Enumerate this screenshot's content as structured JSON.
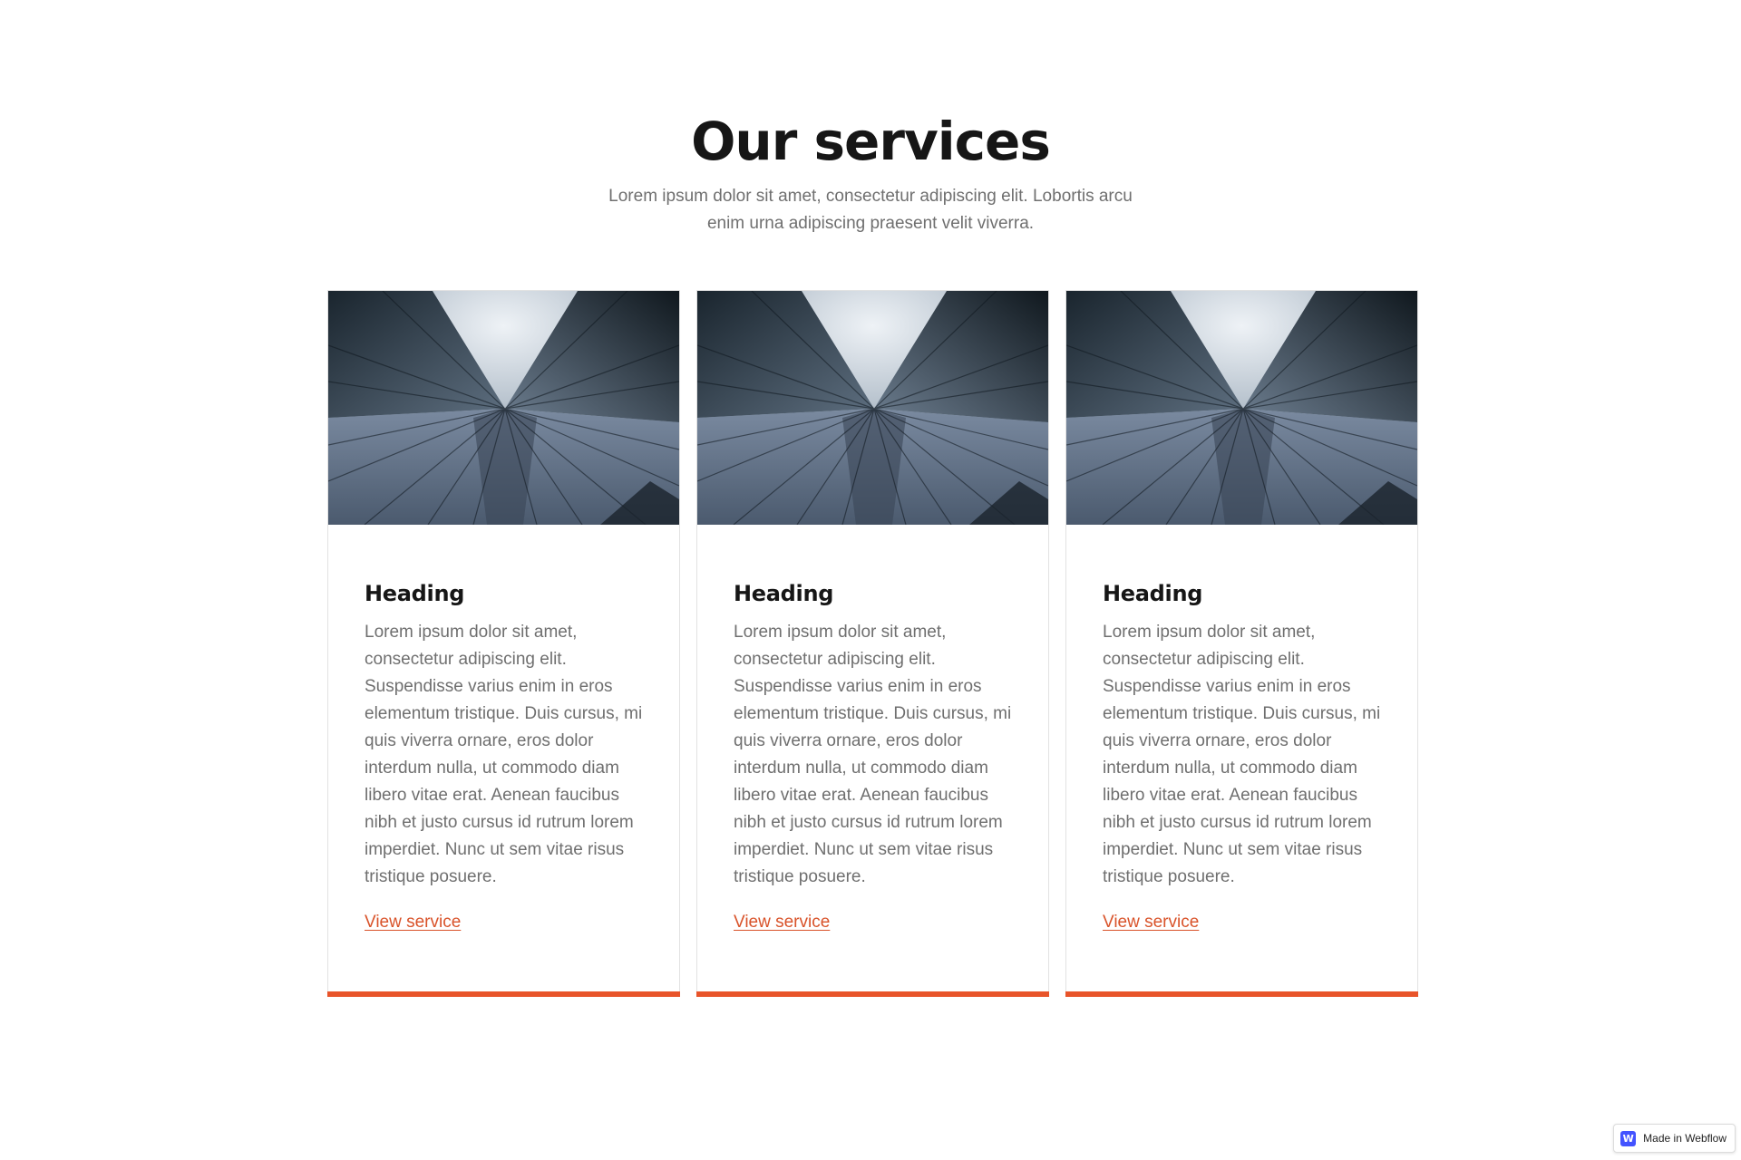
{
  "section": {
    "title": "Our services",
    "subtitle": "Lorem ipsum dolor sit amet, consectetur adipiscing elit. Lobortis arcu enim urna adipiscing praesent velit viverra."
  },
  "colors": {
    "accent": "#e8542a",
    "link": "#d9532a"
  },
  "cards": [
    {
      "image": "skyscraper-photo",
      "heading": "Heading",
      "text": "Lorem ipsum dolor sit amet, consectetur adipiscing elit. Suspendisse varius enim in eros elementum tristique. Duis cursus, mi quis viverra ornare, eros dolor interdum nulla, ut commodo diam libero vitae erat. Aenean faucibus nibh et justo cursus id rutrum lorem imperdiet. Nunc ut sem vitae risus tristique posuere.",
      "link": "View service"
    },
    {
      "image": "skyscraper-photo",
      "heading": "Heading",
      "text": "Lorem ipsum dolor sit amet, consectetur adipiscing elit. Suspendisse varius enim in eros elementum tristique. Duis cursus, mi quis viverra ornare, eros dolor interdum nulla, ut commodo diam libero vitae erat. Aenean faucibus nibh et justo cursus id rutrum lorem imperdiet. Nunc ut sem vitae risus tristique posuere.",
      "link": "View service"
    },
    {
      "image": "skyscraper-photo",
      "heading": "Heading",
      "text": "Lorem ipsum dolor sit amet, consectetur adipiscing elit. Suspendisse varius enim in eros elementum tristique. Duis cursus, mi quis viverra ornare, eros dolor interdum nulla, ut commodo diam libero vitae erat. Aenean faucibus nibh et justo cursus id rutrum lorem imperdiet. Nunc ut sem vitae risus tristique posuere.",
      "link": "View service"
    }
  ],
  "badge": {
    "icon": "webflow-logo-icon",
    "logo_letter": "W",
    "label": "Made in Webflow"
  }
}
